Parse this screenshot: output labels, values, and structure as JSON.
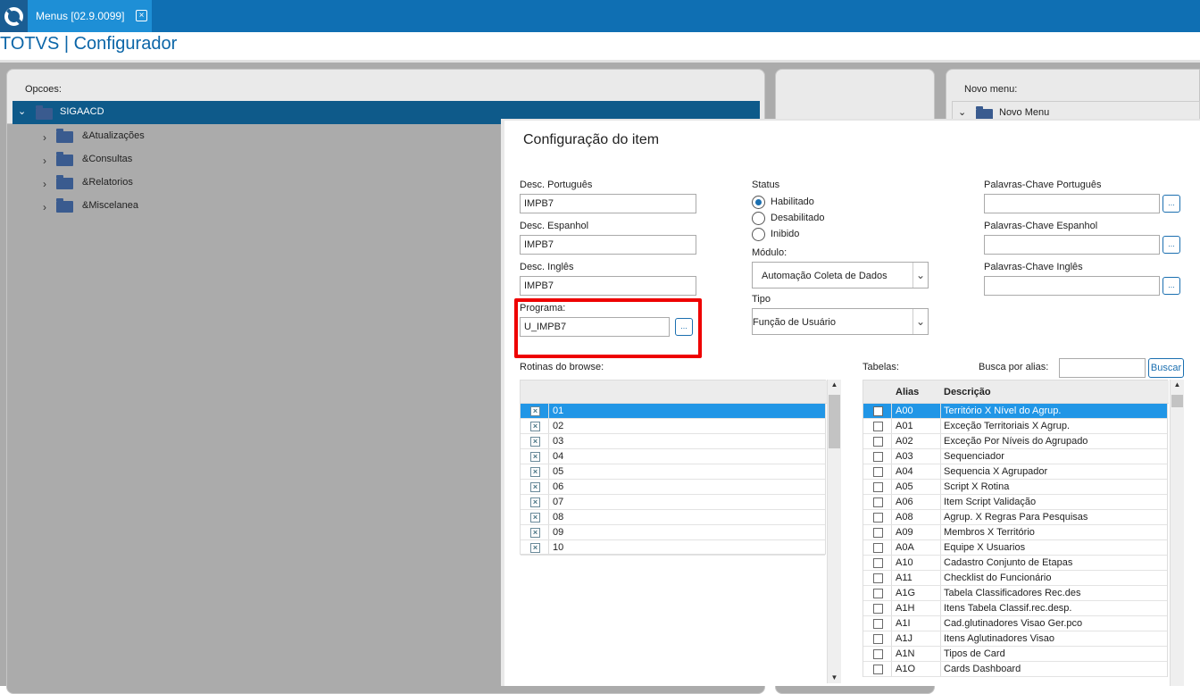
{
  "tab": {
    "title": "Menus [02.9.0099]",
    "close": "×"
  },
  "app_title": "TOTVS | Configurador",
  "opcoes": {
    "label": "Opcoes:",
    "root": "SIGAACD",
    "items": [
      "&Atualizações",
      "&Consultas",
      "&Relatorios",
      "&Miscelanea"
    ]
  },
  "novo_menu": {
    "label": "Novo menu:",
    "root": "Novo Menu"
  },
  "dialog": {
    "title": "Configuração do item",
    "desc_pt_label": "Desc. Português",
    "desc_pt_value": "IMPB7",
    "desc_es_label": "Desc. Espanhol",
    "desc_es_value": "IMPB7",
    "desc_en_label": "Desc. Inglês",
    "desc_en_value": "IMPB7",
    "programa_label": "Programa:",
    "programa_value": "U_IMPB7",
    "dots": "...",
    "status_label": "Status",
    "status_options": [
      "Habilitado",
      "Desabilitado",
      "Inibido"
    ],
    "status_selected": "Habilitado",
    "modulo_label": "Módulo:",
    "modulo_value": "Automação Coleta de Dados",
    "tipo_label": "Tipo",
    "tipo_value": "Função de Usuário",
    "kw_pt_label": "Palavras-Chave Português",
    "kw_es_label": "Palavras-Chave Espanhol",
    "kw_en_label": "Palavras-Chave Inglês",
    "kw_pt_value": "",
    "kw_es_value": "",
    "kw_en_value": "",
    "rotinas_label": "Rotinas do browse:",
    "rotinas": [
      "01",
      "02",
      "03",
      "04",
      "05",
      "06",
      "07",
      "08",
      "09",
      "10"
    ],
    "tabelas_label": "Tabelas:",
    "busca_label": "Busca por alias:",
    "busca_value": "",
    "buscar_button": "Buscar",
    "col_alias": "Alias",
    "col_desc": "Descrição",
    "tabelas": [
      {
        "alias": "A00",
        "desc": "Território X Nível do Agrup."
      },
      {
        "alias": "A01",
        "desc": "Exceção Territoriais X Agrup."
      },
      {
        "alias": "A02",
        "desc": "Exceção Por Níveis do Agrupado"
      },
      {
        "alias": "A03",
        "desc": "Sequenciador"
      },
      {
        "alias": "A04",
        "desc": "Sequencia X Agrupador"
      },
      {
        "alias": "A05",
        "desc": "Script X Rotina"
      },
      {
        "alias": "A06",
        "desc": "Item Script Validação"
      },
      {
        "alias": "A08",
        "desc": "Agrup. X Regras Para Pesquisas"
      },
      {
        "alias": "A09",
        "desc": "Membros X Território"
      },
      {
        "alias": "A0A",
        "desc": "Equipe X Usuarios"
      },
      {
        "alias": "A10",
        "desc": "Cadastro Conjunto de Etapas"
      },
      {
        "alias": "A11",
        "desc": "Checklist do Funcionário"
      },
      {
        "alias": "A1G",
        "desc": "Tabela Classificadores Rec.des"
      },
      {
        "alias": "A1H",
        "desc": "Itens Tabela Classif.rec.desp."
      },
      {
        "alias": "A1I",
        "desc": "Cad.glutinadores Visao Ger.pco"
      },
      {
        "alias": "A1J",
        "desc": "Itens Aglutinadores Visao"
      },
      {
        "alias": "A1N",
        "desc": "Tipos de Card"
      },
      {
        "alias": "A1O",
        "desc": "Cards Dashboard"
      }
    ]
  },
  "colors": {
    "topbar": "#0f6fb3",
    "tab": "#1e8fd6",
    "selection": "#2196e6",
    "highlight": "#ee0000",
    "tree_root": "#0e5a8a"
  }
}
